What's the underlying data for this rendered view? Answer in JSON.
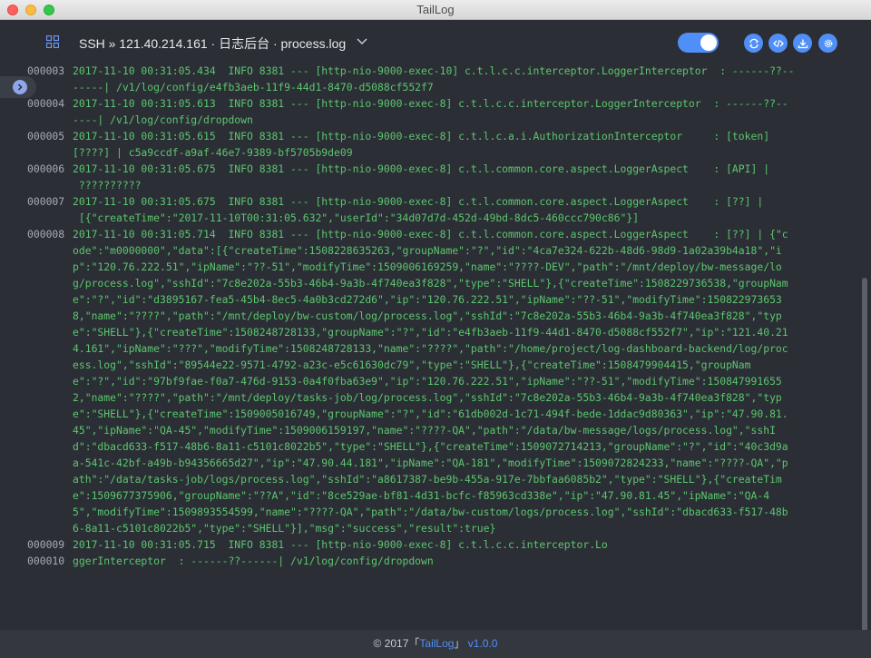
{
  "window": {
    "title": "TailLog"
  },
  "header": {
    "connection_title": "SSH » 121.40.214.161 · 日志后台 · process.log",
    "toggle_on": true,
    "accent_color": "#4f8ff7",
    "buttons": [
      {
        "icon": "refresh-icon"
      },
      {
        "icon": "code-icon"
      },
      {
        "icon": "download-icon"
      },
      {
        "icon": "settings-icon"
      }
    ]
  },
  "side_tab": {
    "icon": "arrow-right-icon"
  },
  "log_lines": [
    {
      "num": "000003",
      "text": "2017-11-10 00:31:05.434  INFO 8381 --- [http-nio-9000-exec-10] c.t.l.c.c.interceptor.LoggerInterceptor  : ------??--"
    },
    {
      "num": "",
      "text": "-----| /v1/log/config/e4fb3aeb-11f9-44d1-8470-d5088cf552f7"
    },
    {
      "num": "000004",
      "text": "2017-11-10 00:31:05.613  INFO 8381 --- [http-nio-9000-exec-8] c.t.l.c.c.interceptor.LoggerInterceptor  : ------??--"
    },
    {
      "num": "",
      "text": "----| /v1/log/config/dropdown"
    },
    {
      "num": "000005",
      "text": "2017-11-10 00:31:05.615  INFO 8381 --- [http-nio-9000-exec-8] c.t.l.c.a.i.AuthorizationInterceptor     : [token]"
    },
    {
      "num": "",
      "text": "[????] | c5a9ccdf-a9af-46e7-9389-bf5705b9de09"
    },
    {
      "num": "000006",
      "text": "2017-11-10 00:31:05.675  INFO 8381 --- [http-nio-9000-exec-8] c.t.l.common.core.aspect.LoggerAspect    : [API] |"
    },
    {
      "num": "",
      "text": " ??????????"
    },
    {
      "num": "000007",
      "text": "2017-11-10 00:31:05.675  INFO 8381 --- [http-nio-9000-exec-8] c.t.l.common.core.aspect.LoggerAspect    : [??] |"
    },
    {
      "num": "",
      "text": " [{\"createTime\":\"2017-11-10T00:31:05.632\",\"userId\":\"34d07d7d-452d-49bd-8dc5-460ccc790c86\"}]"
    },
    {
      "num": "000008",
      "text": "2017-11-10 00:31:05.714  INFO 8381 --- [http-nio-9000-exec-8] c.t.l.common.core.aspect.LoggerAspect    : [??] | {\"c"
    },
    {
      "num": "",
      "text": "ode\":\"m0000000\",\"data\":[{\"createTime\":1508228635263,\"groupName\":\"?\",\"id\":\"4ca7e324-622b-48d6-98d9-1a02a39b4a18\",\"i"
    },
    {
      "num": "",
      "text": "p\":\"120.76.222.51\",\"ipName\":\"??-51\",\"modifyTime\":1509006169259,\"name\":\"????-DEV\",\"path\":\"/mnt/deploy/bw-message/lo"
    },
    {
      "num": "",
      "text": "g/process.log\",\"sshId\":\"7c8e202a-55b3-46b4-9a3b-4f740ea3f828\",\"type\":\"SHELL\"},{\"createTime\":1508229736538,\"groupNam"
    },
    {
      "num": "",
      "text": "e\":\"?\",\"id\":\"d3895167-fea5-45b4-8ec5-4a0b3cd272d6\",\"ip\":\"120.76.222.51\",\"ipName\":\"??-51\",\"modifyTime\":150822973653"
    },
    {
      "num": "",
      "text": "8,\"name\":\"????\",\"path\":\"/mnt/deploy/bw-custom/log/process.log\",\"sshId\":\"7c8e202a-55b3-46b4-9a3b-4f740ea3f828\",\"typ"
    },
    {
      "num": "",
      "text": "e\":\"SHELL\"},{\"createTime\":1508248728133,\"groupName\":\"?\",\"id\":\"e4fb3aeb-11f9-44d1-8470-d5088cf552f7\",\"ip\":\"121.40.21"
    },
    {
      "num": "",
      "text": "4.161\",\"ipName\":\"???\",\"modifyTime\":1508248728133,\"name\":\"????\",\"path\":\"/home/project/log-dashboard-backend/log/proc"
    },
    {
      "num": "",
      "text": "ess.log\",\"sshId\":\"89544e22-9571-4792-a23c-e5c61630dc79\",\"type\":\"SHELL\"},{\"createTime\":1508479904415,\"groupNam"
    },
    {
      "num": "",
      "text": "e\":\"?\",\"id\":\"97bf9fae-f0a7-476d-9153-0a4f0fba63e9\",\"ip\":\"120.76.222.51\",\"ipName\":\"??-51\",\"modifyTime\":150847991655"
    },
    {
      "num": "",
      "text": "2,\"name\":\"????\",\"path\":\"/mnt/deploy/tasks-job/log/process.log\",\"sshId\":\"7c8e202a-55b3-46b4-9a3b-4f740ea3f828\",\"typ"
    },
    {
      "num": "",
      "text": "e\":\"SHELL\"},{\"createTime\":1509005016749,\"groupName\":\"?\",\"id\":\"61db002d-1c71-494f-bede-1ddac9d80363\",\"ip\":\"47.90.81."
    },
    {
      "num": "",
      "text": "45\",\"ipName\":\"QA-45\",\"modifyTime\":1509006159197,\"name\":\"????-QA\",\"path\":\"/data/bw-message/logs/process.log\",\"sshI"
    },
    {
      "num": "",
      "text": "d\":\"dbacd633-f517-48b6-8a11-c5101c8022b5\",\"type\":\"SHELL\"},{\"createTime\":1509072714213,\"groupName\":\"?\",\"id\":\"40c3d9a"
    },
    {
      "num": "",
      "text": "a-541c-42bf-a49b-b94356665d27\",\"ip\":\"47.90.44.181\",\"ipName\":\"QA-181\",\"modifyTime\":1509072824233,\"name\":\"????-QA\",\"p"
    },
    {
      "num": "",
      "text": "ath\":\"/data/tasks-job/logs/process.log\",\"sshId\":\"a8617387-be9b-455a-917e-7bbfaa6085b2\",\"type\":\"SHELL\"},{\"createTim"
    },
    {
      "num": "",
      "text": "e\":1509677375906,\"groupName\":\"??A\",\"id\":\"8ce529ae-bf81-4d31-bcfc-f85963cd338e\",\"ip\":\"47.90.81.45\",\"ipName\":\"QA-4"
    },
    {
      "num": "",
      "text": "5\",\"modifyTime\":1509893554599,\"name\":\"????-QA\",\"path\":\"/data/bw-custom/logs/process.log\",\"sshId\":\"dbacd633-f517-48b"
    },
    {
      "num": "",
      "text": "6-8a11-c5101c8022b5\",\"type\":\"SHELL\"}],\"msg\":\"success\",\"result\":true}"
    },
    {
      "num": "000009",
      "text": "2017-11-10 00:31:05.715  INFO 8381 --- [http-nio-9000-exec-8] c.t.l.c.c.interceptor.Lo"
    },
    {
      "num": "000010",
      "text": "ggerInterceptor  : ------??------| /v1/log/config/dropdown"
    }
  ],
  "footer": {
    "prefix": "© 2017「",
    "brand": "TailLog",
    "suffix": "」",
    "version": "v1.0.0"
  }
}
